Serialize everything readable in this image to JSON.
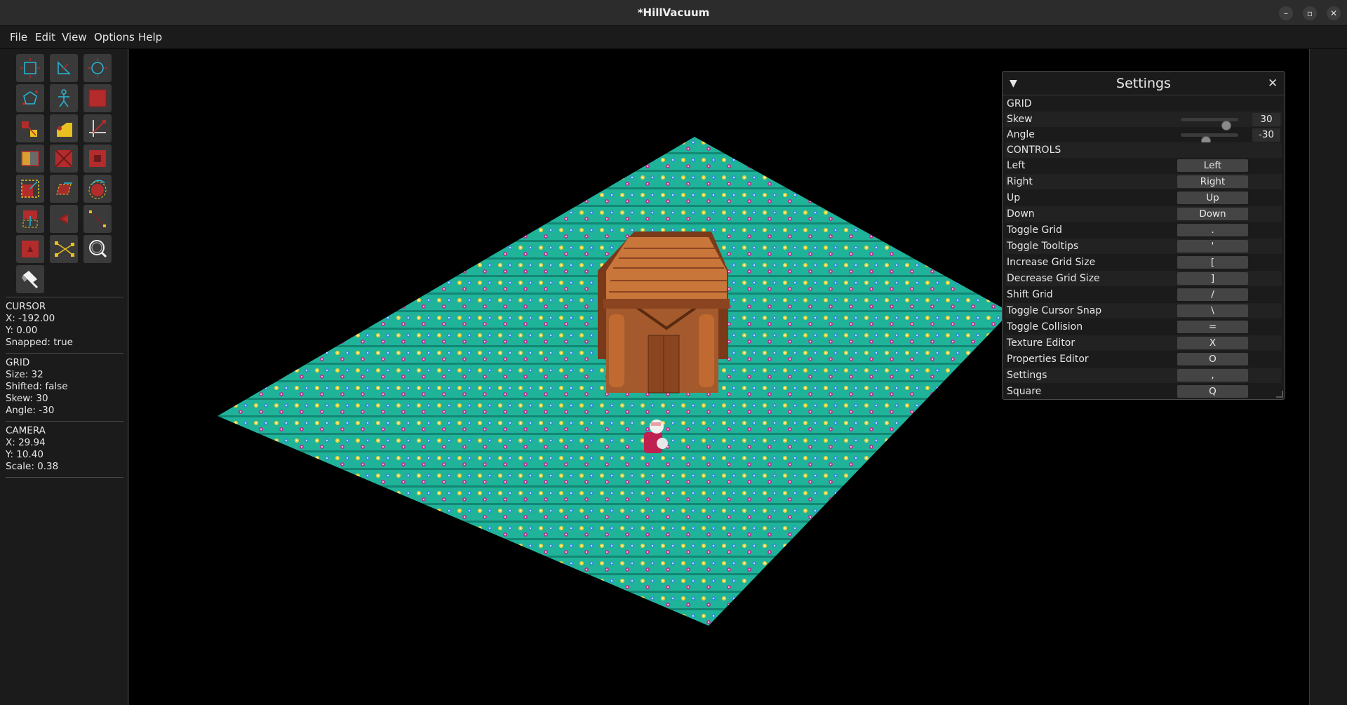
{
  "window": {
    "title": "*HillVacuum",
    "minimize": "–",
    "maximize": "▫",
    "close": "✕"
  },
  "menu": [
    "File",
    "Edit",
    "View",
    "Options",
    "Help"
  ],
  "tools": [
    "square-select-icon",
    "triangle-icon",
    "circle-icon",
    "polygon-icon",
    "entity-thing-icon",
    "draw-square-icon",
    "vertex-tool-icon",
    "side-tool-icon",
    "clip-tool-icon",
    "shatter-tool-icon",
    "subtract-tool-icon",
    "hollow-tool-icon",
    "scale-tool-icon",
    "shear-tool-icon",
    "rotate-tool-icon",
    "flip-tool-icon",
    "intersection-tool-icon",
    "merge-tool-icon",
    "thing-tool-icon",
    "path-tool-icon",
    "zoom-icon",
    "paint-tool-icon"
  ],
  "cursor": {
    "heading": "CURSOR",
    "x": "X: -192.00",
    "y": "Y: 0.00",
    "snapped": "Snapped: true"
  },
  "grid": {
    "heading": "GRID",
    "size": "Size: 32",
    "shifted": "Shifted: false",
    "skew": "Skew: 30",
    "angle": "Angle: -30"
  },
  "camera": {
    "heading": "CAMERA",
    "x": "X: 29.94",
    "y": "Y: 10.40",
    "scale": "Scale: 0.38"
  },
  "settings": {
    "title": "Settings",
    "collapse": "▼",
    "close": "✕",
    "grid_heading": "GRID",
    "skew_label": "Skew",
    "skew_value": "30",
    "skew_fraction": 0.85,
    "angle_label": "Angle",
    "angle_value": "-30",
    "angle_fraction": 0.42,
    "controls_heading": "CONTROLS",
    "controls": [
      {
        "label": "Left",
        "key": "Left"
      },
      {
        "label": "Right",
        "key": "Right"
      },
      {
        "label": "Up",
        "key": "Up"
      },
      {
        "label": "Down",
        "key": "Down"
      },
      {
        "label": "Toggle Grid",
        "key": "."
      },
      {
        "label": "Toggle Tooltips",
        "key": "'"
      },
      {
        "label": "Increase Grid Size",
        "key": "["
      },
      {
        "label": "Decrease Grid Size",
        "key": "]"
      },
      {
        "label": "Shift Grid",
        "key": "/"
      },
      {
        "label": "Toggle Cursor Snap",
        "key": "\\"
      },
      {
        "label": "Toggle Collision",
        "key": "="
      },
      {
        "label": "Texture Editor",
        "key": "X"
      },
      {
        "label": "Properties Editor",
        "key": "O"
      },
      {
        "label": "Settings",
        "key": ","
      },
      {
        "label": "Square",
        "key": "Q"
      }
    ]
  },
  "colors": {
    "grass": "#1fb39a",
    "grass_dark": "#128874",
    "roof": "#c9763a",
    "wall": "#a45a2c",
    "accent": "#27b8d8",
    "tool_red": "#b32b2b",
    "tool_yellow": "#e8c020"
  }
}
